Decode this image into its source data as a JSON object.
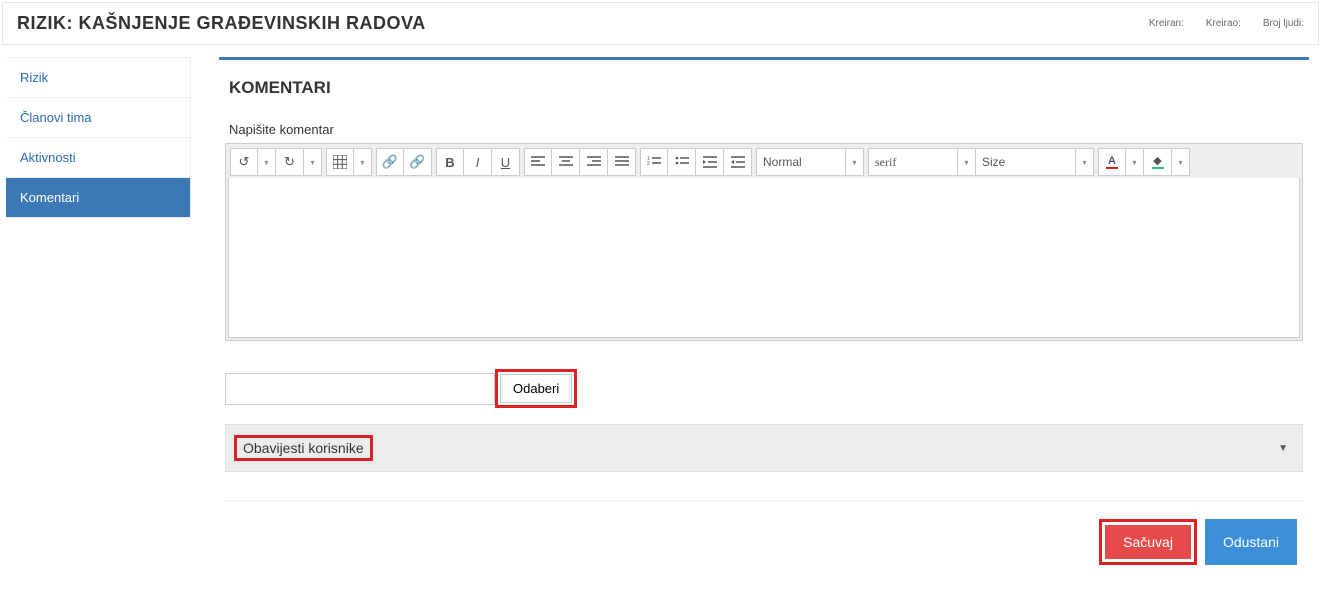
{
  "header": {
    "title": "RIZIK: KAŠNJENJE GRAĐEVINSKIH RADOVA",
    "meta_created_label": "Kreiran:",
    "meta_creator_label": "Kreirao:",
    "meta_people_label": "Broj ljudi:"
  },
  "sidebar": {
    "items": [
      {
        "label": "Rizik"
      },
      {
        "label": "Članovi tima"
      },
      {
        "label": "Aktivnosti"
      },
      {
        "label": "Komentari"
      }
    ],
    "active_index": 3
  },
  "main": {
    "section_title": "KOMENTARI",
    "comment_label": "Napišite komentar",
    "rte": {
      "format_value": "Normal",
      "font_value": "serif",
      "size_value": "Size",
      "color_letter": "A"
    },
    "file_button": "Odaberi",
    "accordion_label": "Obavijesti korisnike",
    "save_label": "Sačuvaj",
    "cancel_label": "Odustani"
  }
}
